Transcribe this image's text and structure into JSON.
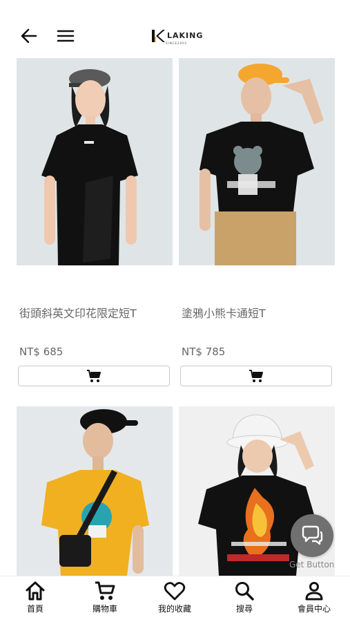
{
  "header": {
    "back_icon": "arrow-left-icon",
    "menu_icon": "hamburger-menu-icon",
    "logo_text": "LAKING",
    "logo_subtext": "SINCE2001"
  },
  "products": [
    {
      "name": "街頭斜英文印花限定短T",
      "price": "NT$ 685",
      "cart_icon": "cart-icon",
      "shirt_color": "#111111",
      "bg_color": "#dfe5e7"
    },
    {
      "name": "塗鴉小熊卡通短T",
      "price": "NT$ 785",
      "cart_icon": "cart-icon",
      "shirt_color": "#111111",
      "bg_color": "#dfe5e7"
    },
    {
      "name": "",
      "price": "",
      "shirt_color": "#f0b020",
      "bg_color": "#e4e8ea"
    },
    {
      "name": "",
      "price": "",
      "shirt_color": "#111111",
      "bg_color": "#f0f0f0"
    }
  ],
  "fab": {
    "label": "Get Button",
    "icon": "chat-bubbles-icon",
    "color": "#707070"
  },
  "bottom_nav": {
    "items": [
      {
        "label": "首頁",
        "icon": "home-icon"
      },
      {
        "label": "購物車",
        "icon": "cart-icon"
      },
      {
        "label": "我的收藏",
        "icon": "heart-icon"
      },
      {
        "label": "搜尋",
        "icon": "search-icon"
      },
      {
        "label": "會員中心",
        "icon": "user-icon"
      }
    ]
  }
}
